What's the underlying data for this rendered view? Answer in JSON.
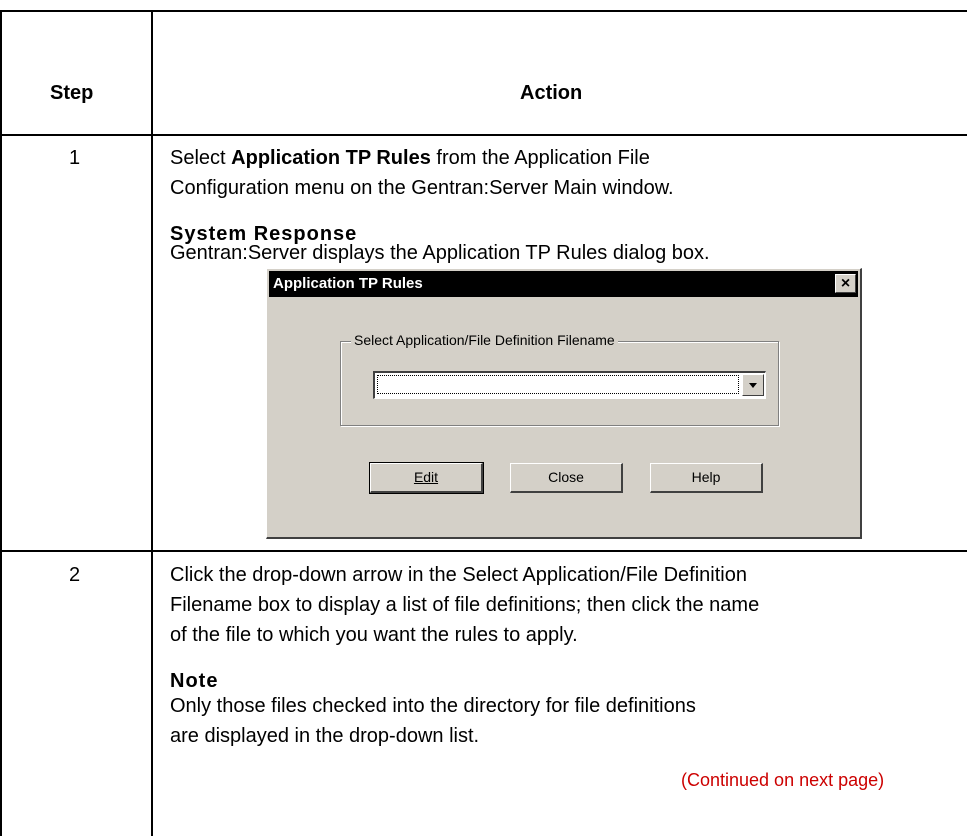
{
  "table": {
    "header": {
      "step": "Step",
      "action": "Action"
    },
    "rows": [
      {
        "step": "1",
        "instruction_pre": "Select ",
        "instruction_bold": "Application TP Rules",
        "instruction_post_line1": " from the Application File",
        "instruction_line2": "Configuration menu on the Gentran:Server Main window.",
        "subheading": "System Response",
        "response": "Gentran:Server displays the Application TP Rules dialog box."
      },
      {
        "step": "2",
        "instruction_lines": [
          "Click the drop-down arrow in the Select Application/File Definition",
          "Filename box to display a list of file definitions; then click the name",
          "of the file to which you want the rules to apply."
        ],
        "subheading": "Note",
        "note_lines": [
          "Only those files checked into the directory for file definitions",
          "are displayed in the drop-down list."
        ],
        "continued": "(Continued on next page)"
      }
    ]
  },
  "dialog": {
    "title": "Application TP Rules",
    "close_glyph": "×",
    "group_label": "Select Application/File Definition Filename",
    "combo_value": "",
    "buttons": {
      "edit": "Edit",
      "close": "Close",
      "help": "Help"
    }
  }
}
